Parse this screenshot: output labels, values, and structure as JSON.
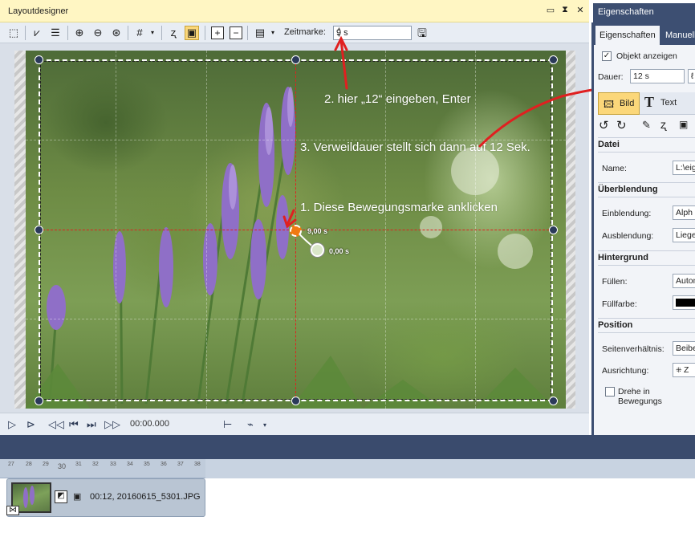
{
  "layoutdesigner": {
    "title": "Layoutdesigner",
    "window_buttons": [
      "▭",
      "⧗",
      "✕"
    ],
    "zeitmarke_label": "Zeitmarke:",
    "zeitmarke_value": "9 s"
  },
  "canvas": {
    "annotations": [
      "2. hier „12“ eingeben, Enter",
      "3. Verweildauer stellt sich dann auf 12 Sek.",
      "1. Diese Bewegungsmarke anklicken"
    ],
    "motion_marks": [
      "9,00 s",
      "0,00 s"
    ]
  },
  "playbar": {
    "time": "00:00.000"
  },
  "properties": {
    "title": "Eigenschaften",
    "tabs": [
      "Eigenschaften",
      "Manuell"
    ],
    "objekt_anzeigen": "Objekt anzeigen",
    "objekt_anzeigen_checked": true,
    "dauer_label": "Dauer:",
    "dauer_value": "12 s",
    "subtabs": [
      "Bild",
      "Text"
    ],
    "sections": {
      "datei": "Datei",
      "ueberblendung": "Überblendung",
      "hintergrund": "Hintergrund",
      "position": "Position"
    },
    "name_label": "Name:",
    "name_value": "L:\\eig",
    "einblendung_label": "Einblendung:",
    "einblendung_value": "Alph",
    "ausblendung_label": "Ausblendung:",
    "ausblendung_value": "Liege",
    "fuellen_label": "Füllen:",
    "fuellen_value": "Autom",
    "fuellfarbe_label": "Füllfarbe:",
    "fuellfarbe_color": "#000000",
    "seitenverhaeltnis_label": "Seitenverhältnis:",
    "seitenverhaeltnis_value": "Beibe",
    "ausrichtung_label": "Ausrichtung:",
    "ausrichtung_value": "Z",
    "drehe_label": "Drehe in Bewegungs"
  },
  "timeline": {
    "ruler_ticks": [
      "27",
      "28",
      "29",
      "30",
      "31",
      "32",
      "33",
      "34",
      "35",
      "36",
      "37",
      "38"
    ],
    "clip_label": "00:12, 20160615_5301.JPG"
  },
  "colors": {
    "title_bar": "#fff6c3",
    "panel_dark": "#3d4f72",
    "annotation_red": "#e02020"
  }
}
